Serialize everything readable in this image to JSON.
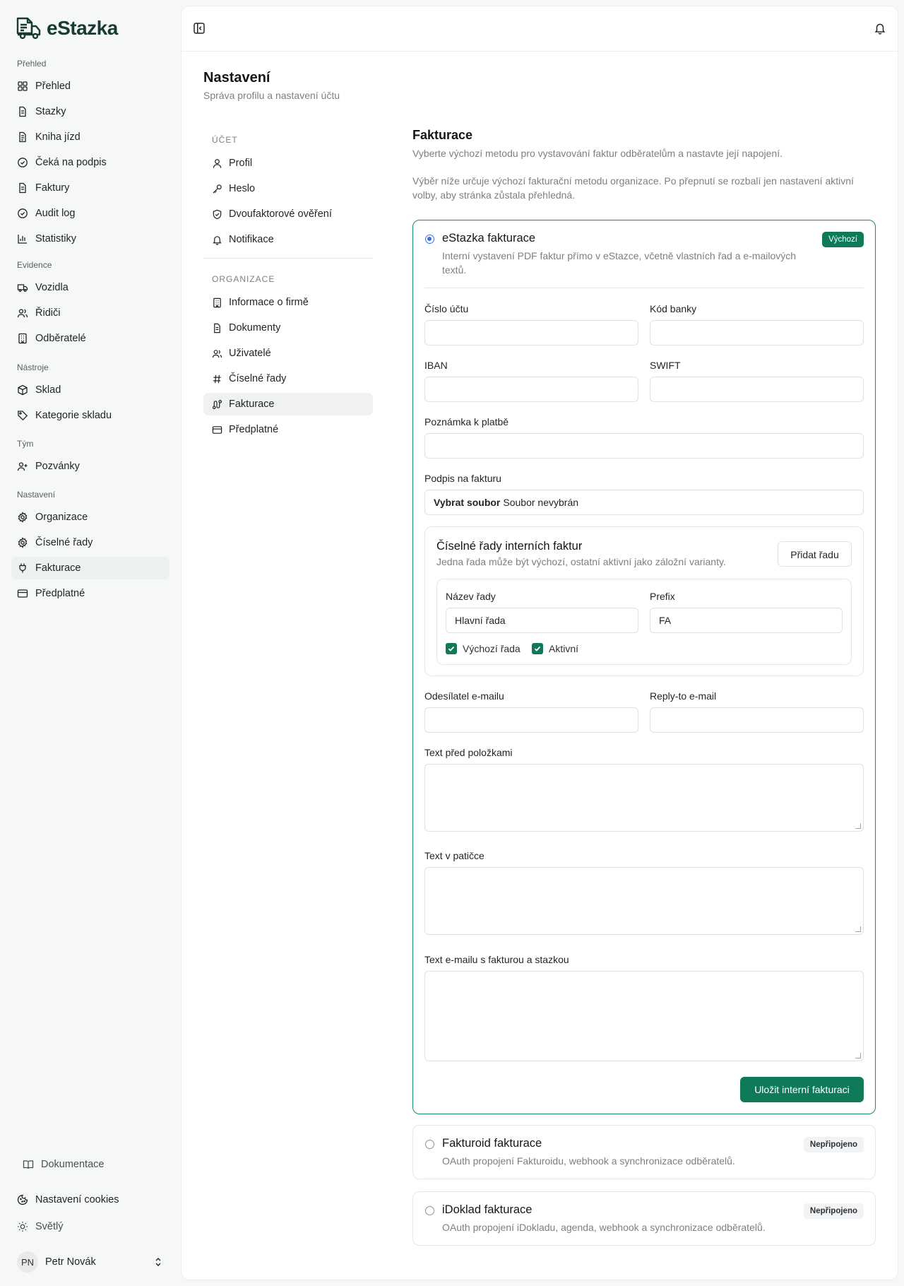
{
  "app": {
    "name": "eStazka"
  },
  "sidebar": {
    "groups": [
      {
        "title": "Přehled",
        "items": [
          {
            "label": "Přehled",
            "icon": "grid-icon"
          },
          {
            "label": "Stazky",
            "icon": "file-icon"
          },
          {
            "label": "Kniha jízd",
            "icon": "book-icon"
          },
          {
            "label": "Čeká na podpis",
            "icon": "check-circle-icon"
          },
          {
            "label": "Faktury",
            "icon": "invoice-icon"
          },
          {
            "label": "Audit log",
            "icon": "check-circle-icon"
          },
          {
            "label": "Statistiky",
            "icon": "bar-chart-icon"
          }
        ]
      },
      {
        "title": "Evidence",
        "items": [
          {
            "label": "Vozidla",
            "icon": "truck-icon"
          },
          {
            "label": "Řidiči",
            "icon": "users-icon"
          },
          {
            "label": "Odběratelé",
            "icon": "building-icon"
          }
        ]
      },
      {
        "title": "Nástroje",
        "items": [
          {
            "label": "Sklad",
            "icon": "package-icon"
          },
          {
            "label": "Kategorie skladu",
            "icon": "tag-icon"
          }
        ]
      },
      {
        "title": "Tým",
        "items": [
          {
            "label": "Pozvánky",
            "icon": "user-plus-icon"
          }
        ]
      },
      {
        "title": "Nastavení",
        "items": [
          {
            "label": "Organizace",
            "icon": "gear-icon"
          },
          {
            "label": "Číselné řady",
            "icon": "gear-icon"
          },
          {
            "label": "Fakturace",
            "icon": "plug-icon",
            "active": true
          },
          {
            "label": "Předplatné",
            "icon": "credit-card-icon"
          }
        ]
      }
    ],
    "docs": "Dokumentace",
    "cookies": "Nastavení cookies",
    "theme": "Světlý",
    "user": {
      "initials": "PN",
      "name": "Petr Novák"
    }
  },
  "page": {
    "title": "Nastavení",
    "subtitle": "Správa profilu a nastavení účtu"
  },
  "settings_nav": {
    "account_head": "Účet",
    "account": [
      {
        "label": "Profil",
        "icon": "user-icon"
      },
      {
        "label": "Heslo",
        "icon": "key-icon"
      },
      {
        "label": "Dvoufaktorové ověření",
        "icon": "shield-icon"
      },
      {
        "label": "Notifikace",
        "icon": "bell-icon"
      }
    ],
    "org_head": "Organizace",
    "org": [
      {
        "label": "Informace o firmě",
        "icon": "building-icon"
      },
      {
        "label": "Dokumenty",
        "icon": "file-icon"
      },
      {
        "label": "Uživatelé",
        "icon": "users-icon"
      },
      {
        "label": "Číselné řady",
        "icon": "hash-icon"
      },
      {
        "label": "Fakturace",
        "icon": "route-icon",
        "active": true
      },
      {
        "label": "Předplatné",
        "icon": "credit-card-icon"
      }
    ]
  },
  "billing": {
    "title": "Fakturace",
    "subtitle": "Vyberte výchozí metodu pro vystavování faktur odběratelům a nastavte její napojení.",
    "note": "Výběr níže určuje výchozí fakturační metodu organizace. Po přepnutí se rozbalí jen nastavení aktivní volby, aby stránka zůstala přehledná.",
    "estazka": {
      "title": "eStazka fakturace",
      "badge": "Výchozí",
      "desc": "Interní vystavení PDF faktur přímo v eStazce, včetně vlastních řad a e-mailových textů.",
      "account_label": "Číslo účtu",
      "account_value": "",
      "bank_label": "Kód banky",
      "bank_value": "",
      "iban_label": "IBAN",
      "iban_value": "",
      "swift_label": "SWIFT",
      "swift_value": "",
      "payment_note_label": "Poznámka k platbě",
      "payment_note_value": "",
      "signature_label": "Podpis na fakturu",
      "file_button": "Vybrat soubor",
      "file_status": "Soubor nevybrán",
      "series": {
        "title": "Číselné řady interních faktur",
        "desc": "Jedna řada může být výchozí, ostatní aktivní jako záložní varianty.",
        "add_button": "Přidat řadu",
        "name_label": "Název řady",
        "name_value": "Hlavní řada",
        "prefix_label": "Prefix",
        "prefix_value": "FA",
        "default_label": "Výchozí řada",
        "default_checked": true,
        "active_label": "Aktivní",
        "active_checked": true
      },
      "sender_label": "Odesílatel e-mailu",
      "sender_value": "",
      "replyto_label": "Reply-to e-mail",
      "replyto_value": "",
      "pre_items_label": "Text před položkami",
      "footer_label": "Text v patičce",
      "email_text_label": "Text e-mailu s fakturou a stazkou",
      "save_button": "Uložit interní fakturaci"
    },
    "fakturoid": {
      "title": "Fakturoid fakturace",
      "badge": "Nepřipojeno",
      "desc": "OAuth propojení Fakturoidu, webhook a synchronizace odběratelů."
    },
    "idoklad": {
      "title": "iDoklad fakturace",
      "badge": "Nepřipojeno",
      "desc": "OAuth propojení iDokladu, agenda, webhook a synchronizace odběratelů."
    }
  },
  "colors": {
    "accent": "#0f7a59",
    "radio": "#3b6fd8"
  }
}
